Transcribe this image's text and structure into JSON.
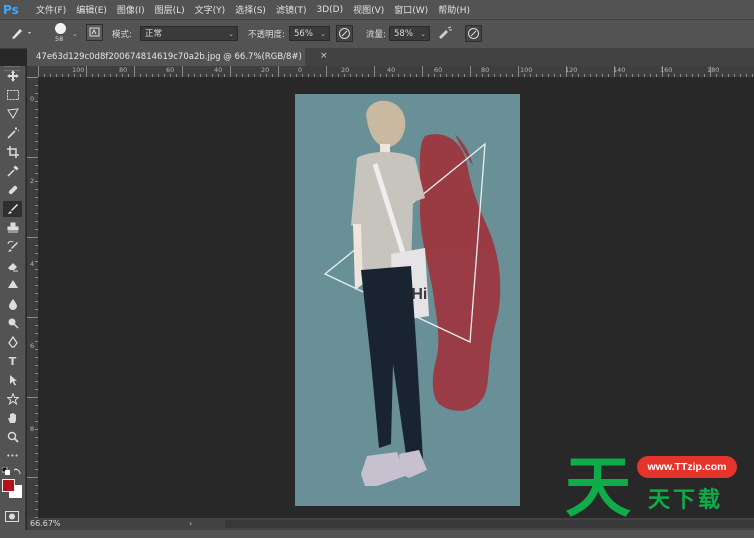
{
  "app": {
    "logo": "Ps"
  },
  "menu": [
    "文件(F)",
    "编辑(E)",
    "图像(I)",
    "图层(L)",
    "文字(Y)",
    "选择(S)",
    "滤镜(T)",
    "3D(D)",
    "视图(V)",
    "窗口(W)",
    "帮助(H)"
  ],
  "options": {
    "brush_size": "58",
    "mode_label": "模式:",
    "mode_value": "正常",
    "opacity_label": "不透明度:",
    "opacity_value": "56%",
    "flow_label": "流量:",
    "flow_value": "58%"
  },
  "document": {
    "tab_title": "47e63d129c0d8f200674814619c70a2b.jpg @ 66.7%(RGB/8#) *",
    "close_glyph": "×"
  },
  "ruler_top": [
    "100",
    "80",
    "60",
    "40",
    "20",
    "0",
    "20",
    "40",
    "60",
    "80",
    "100",
    "120",
    "140",
    "160",
    "180"
  ],
  "ruler_left": [
    "0",
    "2",
    "4",
    "6",
    "8"
  ],
  "status": {
    "zoom": "66.67%",
    "arrow": "›"
  },
  "colors": {
    "foreground": "#b4121a",
    "background": "#ffffff",
    "canvas_bg": "#6a9097",
    "paint_red": "#a8242e",
    "watermark_red": "#e5342c",
    "watermark_green": "#0ead4a"
  },
  "watermark": {
    "url": "www.TTzip.com",
    "big_char": "天",
    "text": "天下载"
  },
  "tools": [
    "move-icon",
    "marquee-icon",
    "lasso-icon",
    "magic-wand-icon",
    "crop-icon",
    "eyedropper-icon",
    "healing-icon",
    "brush-icon",
    "stamp-icon",
    "history-brush-icon",
    "eraser-icon",
    "gradient-icon",
    "blur-icon",
    "dodge-icon",
    "pen-icon",
    "type-icon",
    "path-select-icon",
    "shape-icon",
    "hand-icon",
    "zoom-icon",
    "more-icon"
  ],
  "tool_glyphs": {
    "type": "T",
    "more": "•••"
  }
}
